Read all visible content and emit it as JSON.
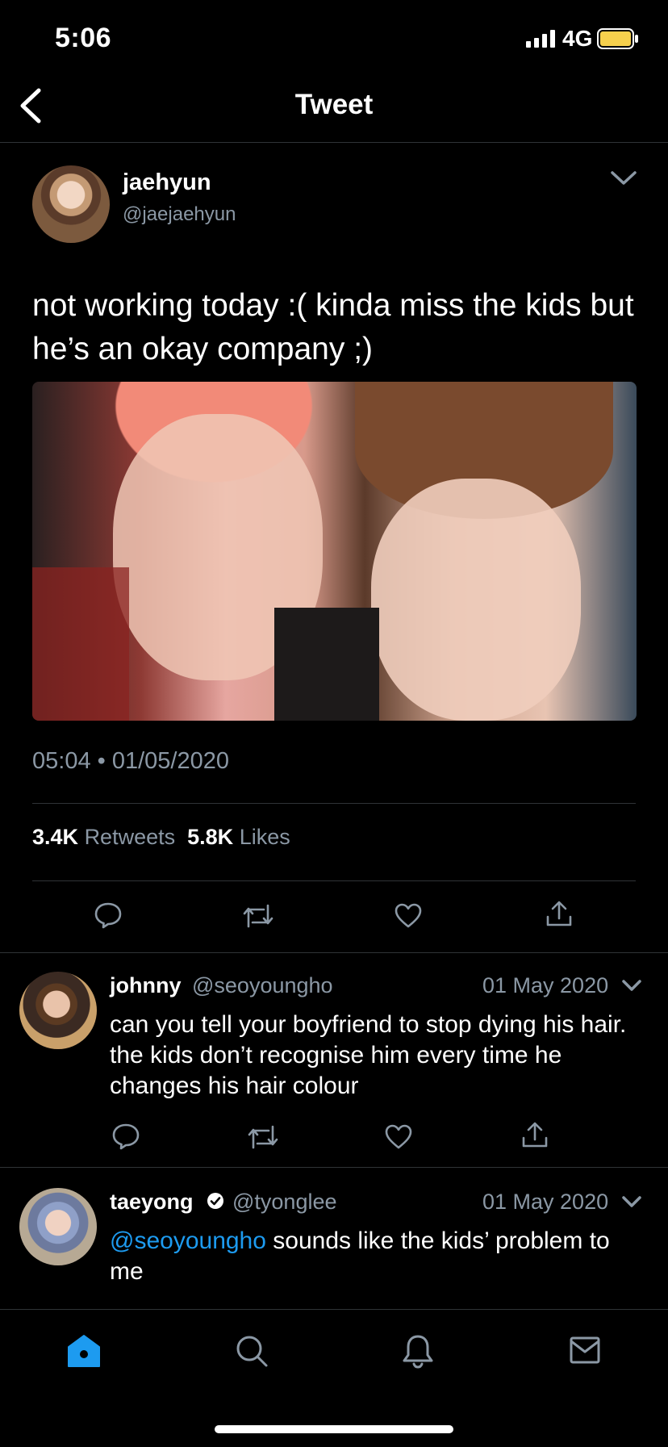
{
  "status_bar": {
    "time": "5:06",
    "network": "4G",
    "battery_color": "#f6d04d"
  },
  "nav": {
    "title": "Tweet"
  },
  "tweet": {
    "author": {
      "name": "jaehyun",
      "handle": "@jaejaehyun"
    },
    "text": "not working today :( kinda miss the kids but he’s an okay company ;)",
    "timestamp": "05:04 • 01/05/2020",
    "retweets_count": "3.4K",
    "retweets_label": "Retweets",
    "likes_count": "5.8K",
    "likes_label": "Likes",
    "actions": [
      "reply-icon",
      "retweet-icon",
      "like-icon",
      "share-icon"
    ]
  },
  "replies": [
    {
      "name": "johnny",
      "handle": "@seoyoungho",
      "date": "01 May 2020",
      "text": "can you tell your boyfriend to stop dying his hair. the kids don’t recognise him every time he changes his hair colour"
    },
    {
      "name": "taeyong",
      "verified": true,
      "handle": "@tyonglee",
      "date": "01 May 2020",
      "mention": "@seoyoungho",
      "text": " sounds like the kids’ problem to me"
    }
  ],
  "tab_bar": {
    "items": [
      "home-icon",
      "search-icon",
      "notifications-icon",
      "messages-icon"
    ],
    "active_color": "#1d9bf0",
    "inactive_color": "#8b98a5"
  },
  "colors": {
    "background": "#000000",
    "muted": "#8b98a5",
    "accent": "#1d9bf0",
    "divider": "#2f3336"
  }
}
